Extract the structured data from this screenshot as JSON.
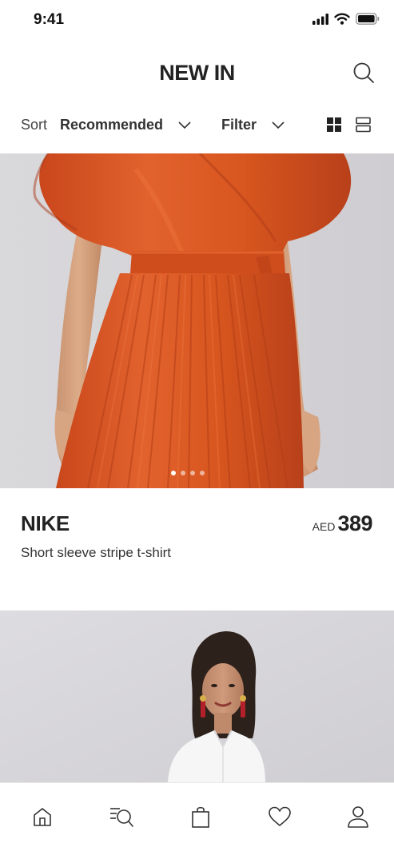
{
  "status_bar": {
    "time": "9:41"
  },
  "header": {
    "title": "NEW IN"
  },
  "sort_bar": {
    "sort_label": "Sort",
    "sort_value": "Recommended",
    "filter_label": "Filter"
  },
  "product": {
    "brand": "NIKE",
    "currency": "AED",
    "price": "389",
    "name": "Short sleeve stripe t-shirt",
    "image_count": 4,
    "active_image": 1
  },
  "colors": {
    "dress": "#dd5a28",
    "text": "#222222",
    "photo_bg": "#d5d3d6"
  },
  "tab_bar": {
    "icons": [
      "home-icon",
      "search-list-icon",
      "shopping-bag-icon",
      "heart-icon",
      "profile-icon"
    ]
  }
}
